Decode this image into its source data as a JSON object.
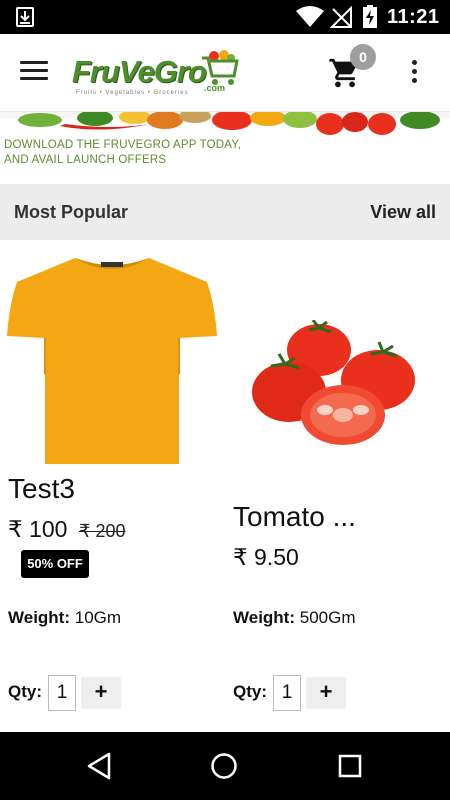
{
  "status_bar": {
    "time": "11:21"
  },
  "app_bar": {
    "logo_text": "FruVeGro",
    "logo_suffix": ".com",
    "logo_tagline": "Fruits • Vegetables • Groceries",
    "cart_count": "0"
  },
  "banner": {
    "line1": "DOWNLOAD THE FRUVEGRO APP TODAY,",
    "line2": "AND AVAIL LAUNCH OFFERS"
  },
  "section": {
    "title": "Most Popular",
    "view_all": "View all"
  },
  "products": [
    {
      "name": "Test3",
      "price": "₹ 100",
      "mrp": "₹ 200",
      "discount": "50% OFF",
      "weight_label": "Weight:",
      "weight": "10Gm",
      "qty_label": "Qty:",
      "qty": "1",
      "plus": "+"
    },
    {
      "name": "Tomato ...",
      "price": "₹ 9.50",
      "weight_label": "Weight:",
      "weight": "500Gm",
      "qty_label": "Qty:",
      "qty": "1",
      "plus": "+"
    }
  ],
  "colors": {
    "brand_green": "#4c8f2c",
    "banner_text": "#5a8f2b",
    "section_bg": "#ececec",
    "badge_bg": "#000000",
    "tshirt": "#f3a712",
    "tomato": "#e8301c"
  },
  "icons": [
    "download-icon",
    "wifi-icon",
    "no-signal-icon",
    "battery-charging-icon",
    "menu-icon",
    "cart-icon",
    "more-vert-icon",
    "back-icon",
    "home-icon",
    "recents-icon"
  ]
}
